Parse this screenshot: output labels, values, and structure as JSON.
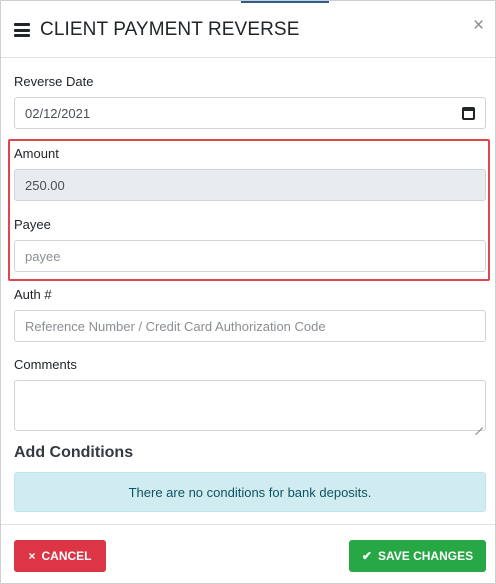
{
  "header": {
    "title": "CLIENT PAYMENT REVERSE",
    "close_glyph": "×"
  },
  "form": {
    "reverse_date": {
      "label": "Reverse Date",
      "value": "02/12/2021"
    },
    "amount": {
      "label": "Amount",
      "value": "250.00"
    },
    "payee": {
      "label": "Payee",
      "placeholder": "payee"
    },
    "auth": {
      "label": "Auth #",
      "placeholder": "Reference Number / Credit Card Authorization Code"
    },
    "comments": {
      "label": "Comments",
      "value": ""
    }
  },
  "conditions": {
    "title": "Add Conditions",
    "message": "There are no conditions for bank deposits."
  },
  "footer": {
    "cancel_label": "CANCEL",
    "save_label": "SAVE CHANGES",
    "cancel_icon": "×",
    "save_icon": "✔"
  },
  "colors": {
    "cancel": "#dc3545",
    "save": "#28a745",
    "highlight": "#e0474c",
    "info_bg": "#d1ecf1"
  },
  "icons": {
    "menu": "hamburger-icon",
    "close": "close-icon",
    "calendar": "calendar-icon",
    "cancel": "times-icon",
    "save": "check-icon"
  }
}
